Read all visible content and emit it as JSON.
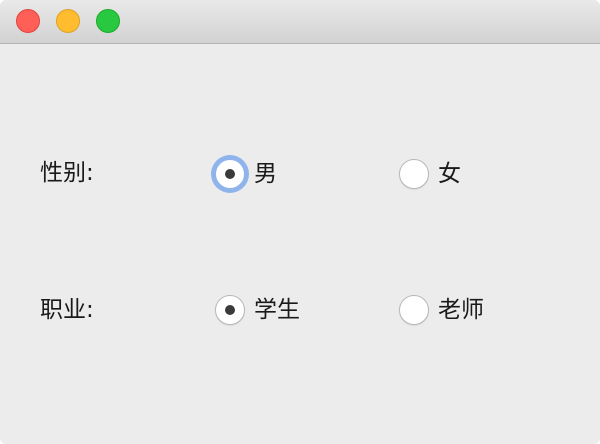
{
  "window": {
    "controls": {
      "close": "close-icon",
      "minimize": "minimize-icon",
      "zoom": "zoom-icon"
    }
  },
  "form": {
    "gender": {
      "label": "性别:",
      "options": [
        {
          "label": "男",
          "checked": true,
          "focused": true
        },
        {
          "label": "女",
          "checked": false,
          "focused": false
        }
      ]
    },
    "occupation": {
      "label": "职业:",
      "options": [
        {
          "label": "学生",
          "checked": true,
          "focused": false
        },
        {
          "label": "老师",
          "checked": false,
          "focused": false
        }
      ]
    }
  },
  "colors": {
    "window_bg": "#ececec",
    "focus_ring": "#8fb4ec",
    "close": "#fe5f57",
    "minimize": "#febc2e",
    "zoom": "#28c840"
  }
}
